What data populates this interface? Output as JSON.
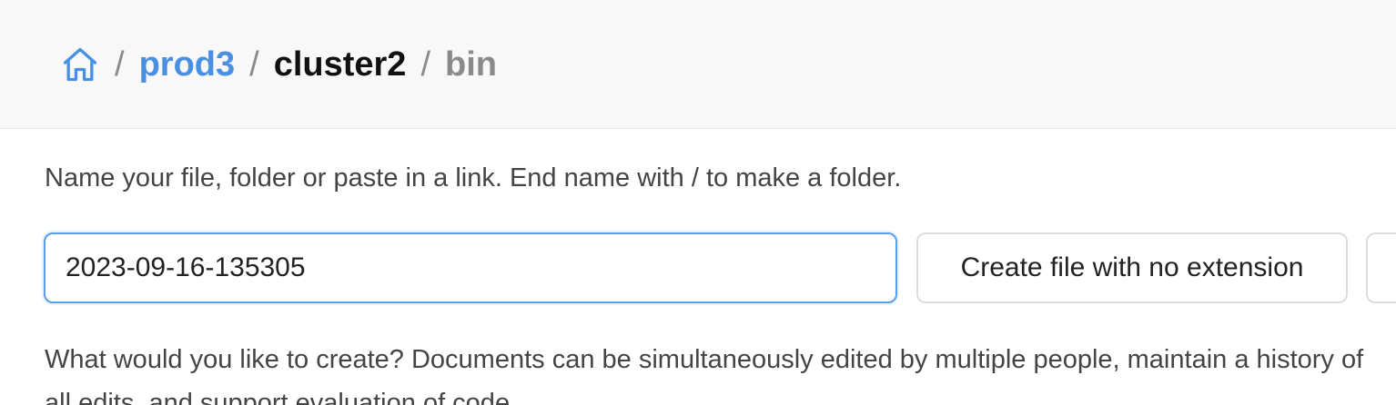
{
  "breadcrumb": {
    "home_icon": "home-icon",
    "separator": "/",
    "items": [
      {
        "label": "prod3"
      },
      {
        "label": "cluster2"
      },
      {
        "label": "bin"
      }
    ]
  },
  "form": {
    "instruction": "Name your file, folder or paste in a link. End name with / to make a folder.",
    "name_value": "2023-09-16-135305",
    "create_button_label": "Create file with no extension"
  },
  "description": "What would you like to create? Documents can be simultaneously edited by multiple people, maintain a history of all edits, and support evaluation of code.",
  "colors": {
    "link": "#4a90e2",
    "focus_border": "#5b9ee8",
    "header_bg": "#f8f8f8"
  }
}
